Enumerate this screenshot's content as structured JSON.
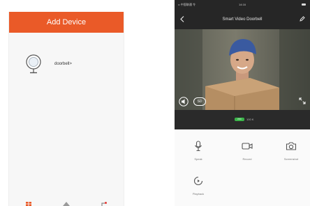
{
  "add_device_screen": {
    "header_title": "Add Device",
    "device": {
      "name": "doorbell>",
      "icon": "doorbell-device-icon"
    },
    "tabbar": {
      "icons": [
        "home-icon",
        "cloud-icon",
        "settings-icon"
      ],
      "accent_color": "#ea5a28"
    }
  },
  "doorbell_screen": {
    "status_bar": {
      "signal": "•• 中国联通 令",
      "time": "14:16"
    },
    "title": "Smart Video Doorbell",
    "icons": {
      "back": "back-chevron-icon",
      "edit": "edit-pencil-icon",
      "sound": "speaker-icon",
      "fullscreen": "fullscreen-icon"
    },
    "quality": "SD",
    "signal": {
      "badge": "WiFi",
      "text": "100 K"
    },
    "controls": {
      "speak": "Speak",
      "record": "Record",
      "screenshot": "Screenshot",
      "playback": "Playback"
    }
  },
  "colors": {
    "header": "#ea5a28",
    "dark_bar": "#262626",
    "signal_green": "#3bb54a"
  }
}
